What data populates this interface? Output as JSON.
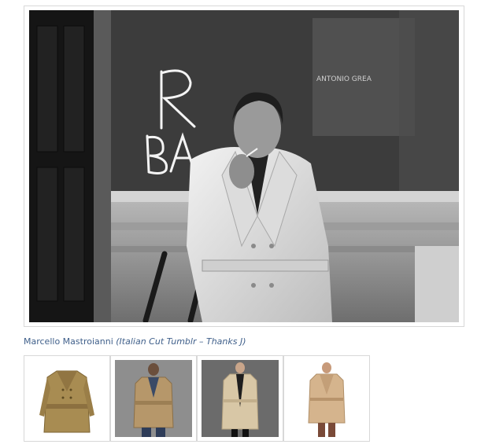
{
  "caption": {
    "name": "Marcello Mastroianni",
    "source": "(Italian Cut Tumblr – Thanks J)"
  },
  "main_image": {
    "graffiti_text": "R BA",
    "wall_sign_text": "ANTONIO GREA"
  },
  "thumbnails": [
    {
      "label": "Khaki trench coat product shot",
      "icon": "trench-coat-icon"
    },
    {
      "label": "Model in tan trench coat and jeans",
      "icon": "trench-coat-icon"
    },
    {
      "label": "Model in beige trench coat on grey",
      "icon": "trench-coat-icon"
    },
    {
      "label": "Model in light trench coat on white",
      "icon": "trench-coat-icon"
    }
  ],
  "colors": {
    "caption_link": "#3f5f8a",
    "frame_border": "#d8d8d8",
    "khaki": "#a88c52",
    "tan": "#b6976a",
    "beige": "#d8c7a6",
    "light_tan": "#d5b48d"
  }
}
